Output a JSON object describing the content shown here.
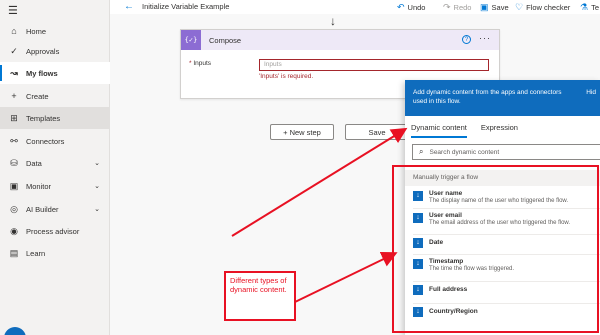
{
  "sidebar": {
    "menu_icon": "hamburger-icon",
    "items": [
      {
        "label": "Home",
        "icon": "home-icon",
        "glyph": "⌂",
        "chevron": false
      },
      {
        "label": "Approvals",
        "icon": "approvals-icon",
        "glyph": "✓",
        "chevron": false
      },
      {
        "label": "My flows",
        "icon": "flows-icon",
        "glyph": "↝",
        "chevron": false
      },
      {
        "label": "Create",
        "icon": "plus-icon",
        "glyph": "+",
        "chevron": false
      },
      {
        "label": "Templates",
        "icon": "templates-icon",
        "glyph": "⊞",
        "chevron": false
      },
      {
        "label": "Connectors",
        "icon": "connectors-icon",
        "glyph": "⚯",
        "chevron": false
      },
      {
        "label": "Data",
        "icon": "database-icon",
        "glyph": "⛁",
        "chevron": true
      },
      {
        "label": "Monitor",
        "icon": "monitor-icon",
        "glyph": "▣",
        "chevron": true
      },
      {
        "label": "AI Builder",
        "icon": "ai-builder-icon",
        "glyph": "◎",
        "chevron": true
      },
      {
        "label": "Process advisor",
        "icon": "process-advisor-icon",
        "glyph": "◉",
        "chevron": false
      },
      {
        "label": "Learn",
        "icon": "learn-icon",
        "glyph": "▤",
        "chevron": false
      }
    ]
  },
  "topbar": {
    "title": "Initialize Variable Example",
    "undo": "Undo",
    "redo": "Redo",
    "save": "Save",
    "flow_checker": "Flow checker",
    "test": "Te"
  },
  "card": {
    "icon_text": "{✓}",
    "title": "Compose",
    "input_label": "Inputs",
    "input_placeholder": "Inputs",
    "error": "'Inputs' is required."
  },
  "buttons": {
    "new_step": "+ New step",
    "save": "Save"
  },
  "dynamic": {
    "header": "Add dynamic content from the apps and connectors used in this flow.",
    "hide": "Hid",
    "tabs": [
      "Dynamic content",
      "Expression"
    ],
    "search_placeholder": "Search dynamic content",
    "section": "Manually trigger a flow",
    "items": [
      {
        "name": "User name",
        "desc": "The display name of the user who triggered the flow."
      },
      {
        "name": "User email",
        "desc": "The email address of the user who triggered the flow."
      },
      {
        "name": "Date",
        "desc": ""
      },
      {
        "name": "Timestamp",
        "desc": "The time the flow was triggered."
      },
      {
        "name": "Full address",
        "desc": ""
      },
      {
        "name": "Country/Region",
        "desc": ""
      }
    ]
  },
  "annotation": {
    "text": "Different types of dynamic content."
  },
  "colors": {
    "accent": "#0078d4",
    "annotation": "#e81123",
    "compose": "#8c6cd3"
  }
}
